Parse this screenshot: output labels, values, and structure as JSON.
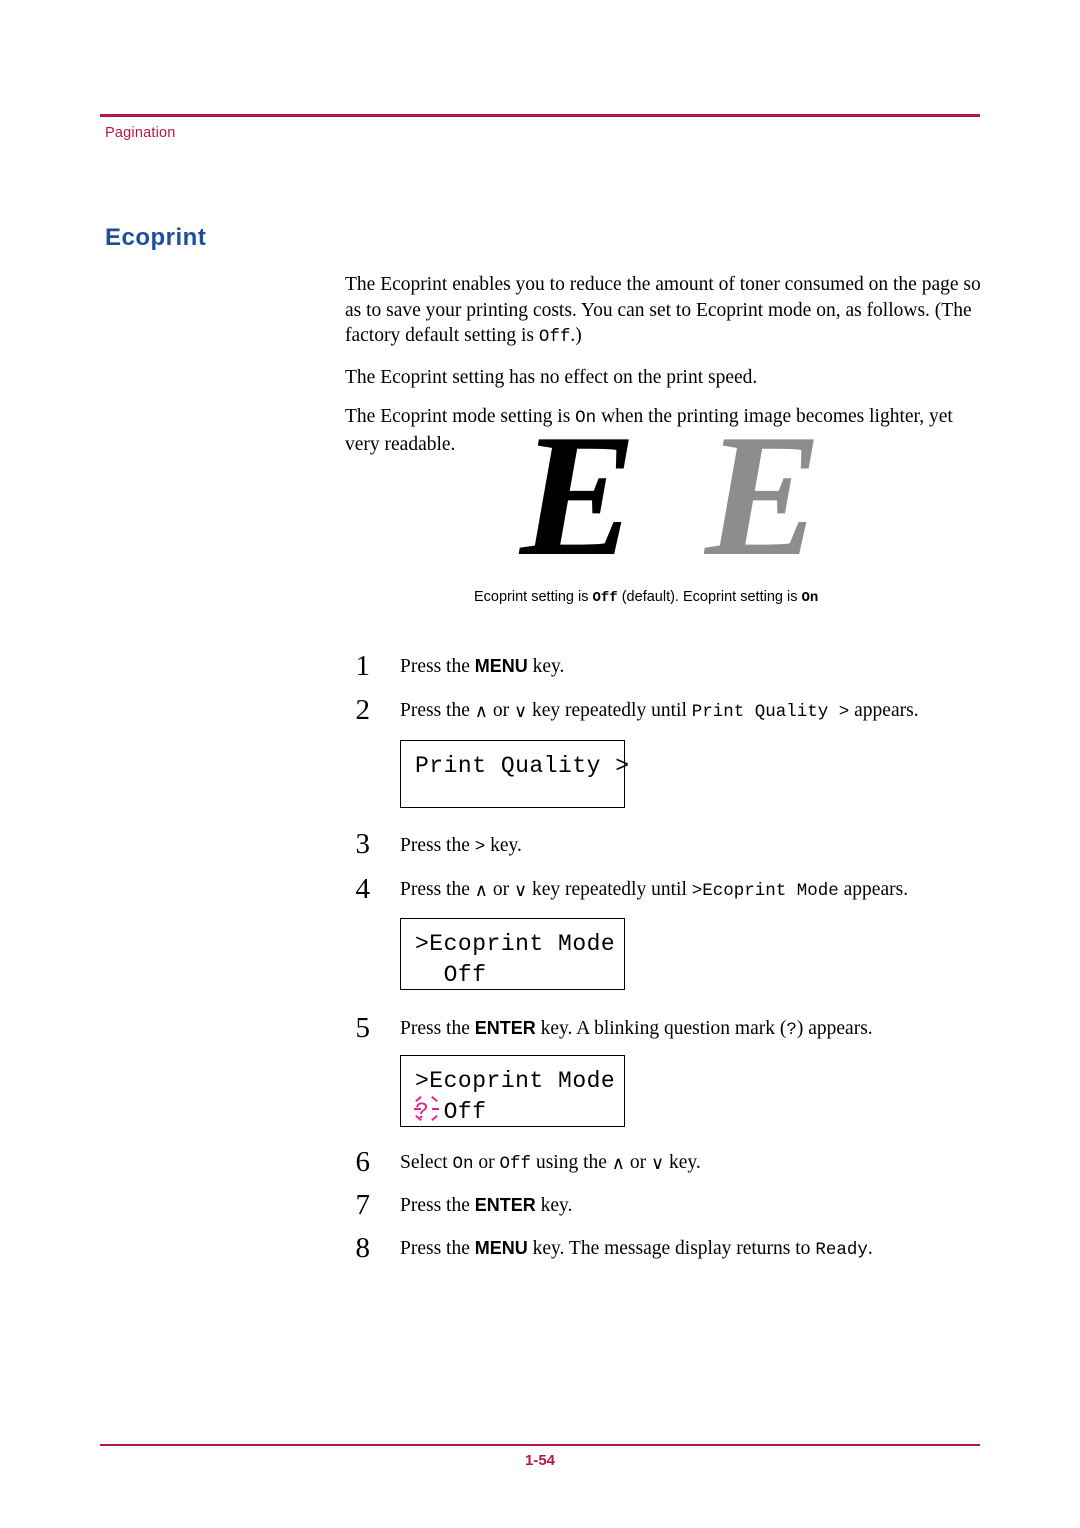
{
  "header": {
    "label": "Pagination"
  },
  "footer": {
    "page_number": "1-54"
  },
  "section": {
    "title": "Ecoprint"
  },
  "paragraphs": {
    "p1_a": "The Ecoprint enables you to reduce the amount of toner consumed on the page so as to save your printing costs. You can set to Ecoprint mode on, as follows. (The factory default setting is ",
    "p1_code": "Off",
    "p1_b": ".)",
    "p2": "The Ecoprint setting has no effect on the print speed.",
    "p3_a": "The Ecoprint mode setting is ",
    "p3_code": "On",
    "p3_b": " when the printing image becomes lighter, yet very readable."
  },
  "figure": {
    "glyph_left": "E",
    "glyph_right": "E",
    "caption_left_a": "Ecoprint setting is ",
    "caption_left_code": "Off",
    "caption_left_b": " (default).",
    "caption_right_a": "Ecoprint setting is ",
    "caption_right_code": "On"
  },
  "steps": [
    {
      "number": "1",
      "text_a": "Press the ",
      "key": "MENU",
      "text_b": " key."
    },
    {
      "number": "2",
      "text_a": "Press the ",
      "arrow_up": "∧",
      "text_or": " or ",
      "arrow_down": "∨",
      "text_b": " key repeatedly until ",
      "code": "Print Quality >",
      "text_c": " appears."
    },
    {
      "number": "3",
      "text_a": "Press the ",
      "code": ">",
      "text_b": " key."
    },
    {
      "number": "4",
      "text_a": "Press the ",
      "arrow_up": "∧",
      "text_or": " or ",
      "arrow_down": "∨",
      "text_b": " key repeatedly until ",
      "code": ">Ecoprint Mode",
      "text_c": " appears."
    },
    {
      "number": "5",
      "text_a": "Press the ",
      "key": "ENTER",
      "text_b": " key. A blinking question mark (",
      "code": "?",
      "text_c": ") appears."
    },
    {
      "number": "6",
      "text_a": "Select ",
      "code1": "On",
      "text_b": " or ",
      "code2": "Off",
      "text_c": " using the ",
      "arrow_up": "∧",
      "text_or": " or ",
      "arrow_down": "∨",
      "text_d": " key."
    },
    {
      "number": "7",
      "text_a": "Press the ",
      "key": "ENTER",
      "text_b": " key."
    },
    {
      "number": "8",
      "text_a": "Press the ",
      "key": "MENU",
      "text_b": " key. The message display returns to ",
      "code": "Ready",
      "text_c": "."
    }
  ],
  "lcd_panels": [
    {
      "id": "panel-print-quality",
      "line1": "Print Quality >",
      "line2": ""
    },
    {
      "id": "panel-ecoprint-mode",
      "line1": ">Ecoprint Mode",
      "line2": "  Off"
    },
    {
      "id": "panel-ecoprint-mode-blink",
      "line1": ">Ecoprint Mode",
      "line2_prefix": "?",
      "line2": " Off"
    }
  ]
}
